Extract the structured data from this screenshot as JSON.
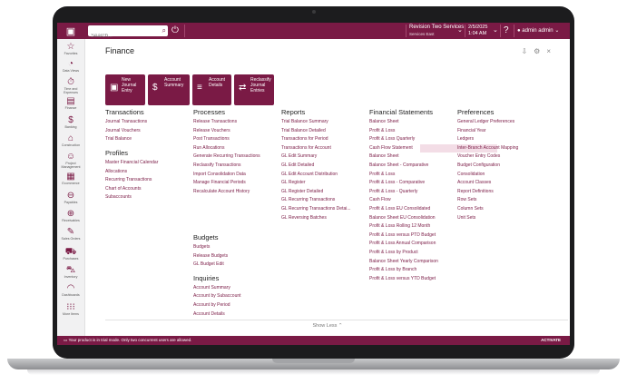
{
  "topbar": {
    "search_placeholder": "Search...",
    "company": "Revision Two Services",
    "company_sub": "Services East",
    "date": "2/5/2025",
    "time": "1:04 AM",
    "user": "admin admin",
    "bg_color": "#7a1a45"
  },
  "leftnav": [
    {
      "label": "Favorites",
      "icon": "star-icon",
      "glyph": "☆"
    },
    {
      "label": "Data Views",
      "icon": "dashboard-icon",
      "glyph": "◔"
    },
    {
      "label": "Time and Expenses",
      "icon": "clock-icon",
      "glyph": "⏱"
    },
    {
      "label": "Finance",
      "icon": "document-icon",
      "glyph": "▤"
    },
    {
      "label": "Banking",
      "icon": "dollar-icon",
      "glyph": "$"
    },
    {
      "label": "Construction",
      "icon": "crane-icon",
      "glyph": "⌂"
    },
    {
      "label": "Project Management",
      "icon": "people-icon",
      "glyph": "☺"
    },
    {
      "label": "Ecommerce",
      "icon": "browser-icon",
      "glyph": "▦"
    },
    {
      "label": "Payables",
      "icon": "minus-circle-icon",
      "glyph": "⊖"
    },
    {
      "label": "Receivables",
      "icon": "plus-circle-icon",
      "glyph": "⊕"
    },
    {
      "label": "Sales Orders",
      "icon": "edit-icon",
      "glyph": "✎"
    },
    {
      "label": "Purchases",
      "icon": "cart-icon",
      "glyph": "⛟"
    },
    {
      "label": "Inventory",
      "icon": "truck-icon",
      "glyph": "⛍"
    },
    {
      "label": "Dashboards",
      "icon": "gauge-icon",
      "glyph": "◠"
    },
    {
      "label": "More Items",
      "icon": "grid-icon",
      "glyph": "⁝⁝⁝"
    }
  ],
  "page": {
    "title": "Finance",
    "show_less": "Show Less"
  },
  "quick_buttons": [
    {
      "label": [
        "New",
        "Journal",
        "Entry"
      ],
      "icon": "new-document-icon",
      "glyph": "▣"
    },
    {
      "label": [
        "Account",
        "Summary"
      ],
      "icon": "dollar-icon",
      "glyph": "$"
    },
    {
      "label": [
        "Account",
        "Details"
      ],
      "icon": "list-icon",
      "glyph": "≡"
    },
    {
      "label": [
        "Reclassify",
        "Journal",
        "Entries"
      ],
      "icon": "swap-icon",
      "glyph": "⇄"
    }
  ],
  "sections": {
    "transactions": {
      "title": "Transactions",
      "items": [
        "Journal Transactions",
        "Journal Vouchers",
        "Trial Balance"
      ]
    },
    "profiles": {
      "title": "Profiles",
      "items": [
        "Master Financial Calendar",
        "Allocations",
        "Recurring Transactions",
        "Chart of Accounts",
        "Subaccounts"
      ]
    },
    "processes": {
      "title": "Processes",
      "items": [
        "Release Transactions",
        "Release Vouchers",
        "Post Transactions",
        "Run Allocations",
        "Generate Recurring Transactions",
        "Reclassify Transactions",
        "Import Consolidation Data",
        "Manage Financial Periods",
        "Recalculate Account History"
      ]
    },
    "budgets": {
      "title": "Budgets",
      "items": [
        "Budgets",
        "Release Budgets",
        "GL Budget Edit"
      ]
    },
    "inquiries": {
      "title": "Inquiries",
      "items": [
        "Account Summary",
        "Account by Subaccount",
        "Account by Period",
        "Account Details"
      ]
    },
    "reports": {
      "title": "Reports",
      "items": [
        "Trial Balance Summary",
        "Trial Balance Detailed",
        "Transactions for Period",
        "Transactions for Account",
        "GL Edit Summary",
        "GL Edit Detailed",
        "GL Edit Account Distribution",
        "GL Register",
        "GL Register Detailed",
        "GL Recurring Transactions",
        "GL Recurring Transactions Detai...",
        "GL Reversing Batches"
      ]
    },
    "financial_statements": {
      "title": "Financial Statements",
      "items": [
        "Balance Sheet",
        "Profit & Loss",
        "Profit & Loss Quarterly",
        "Cash Flow Statement",
        "Balance Sheet",
        "Balance Sheet - Comparative",
        "Profit & Loss",
        "Profit & Loss - Comparative",
        "Profit & Loss - Quarterly",
        "Cash Flow",
        "Profit & Loss EU Consolidated",
        "Balance Sheet EU Consolidation",
        "Profit & Loss Rolling 12 Month",
        "Profit & Loss versus PTD Budget",
        "Profit & Loss Annual Comparison",
        "Profit & Loss by Product",
        "Balance Sheet Yearly Comparison",
        "Profit & Loss by Branch",
        "Profit & Loss versus YTD Budget"
      ]
    },
    "preferences": {
      "title": "Preferences",
      "items": [
        "General Ledger Preferences",
        "Financial Year",
        "Ledgers",
        "Inter-Branch Account Mapping",
        "Voucher Entry Codes",
        "Budget Configuration",
        "Consolidation",
        "Account Classes",
        "Report Definitions",
        "Row Sets",
        "Column Sets",
        "Unit Sets"
      ]
    }
  },
  "bottombar": {
    "message": "Your product is in trial mode. Only two concurrent users are allowed.",
    "activate": "ACTIVATE"
  }
}
